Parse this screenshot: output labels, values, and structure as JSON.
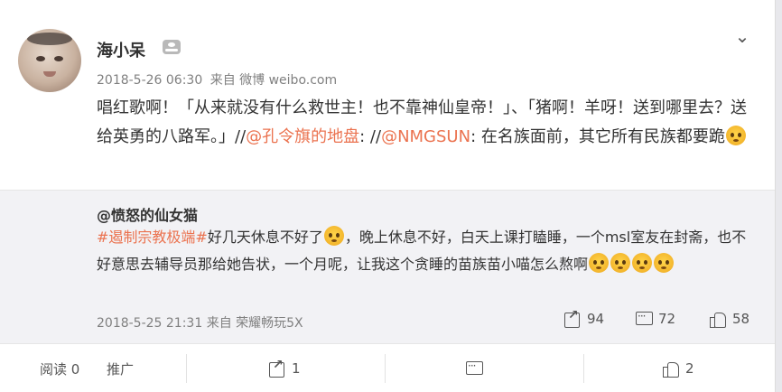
{
  "post": {
    "username": "海小呆",
    "timestamp": "2018-5-26 06:30",
    "source": "来自 微博 weibo.com",
    "text": {
      "p1": "唱红歌啊！「从来就没有什么救世主！也不靠神仙皇帝！」、「猪啊！羊呀！送到哪里去？送给英勇的八路军。」//",
      "mention1": "@孔令旗的地盘",
      "p2": ": //",
      "mention2": "@NMGSUN",
      "p3": ": 在名族面前，其它所有民族都要跪"
    }
  },
  "retweet": {
    "username": "@愤怒的仙女猫",
    "hashtag": "#遏制宗教极端#",
    "text1": "好几天休息不好了",
    "text2": "，晚上休息不好，白天上课打瞌睡，一个msl室友在封斋，也不好意思去辅导员那给她告状，一个月呢，让我这个贪睡的苗族苗小喵怎么熬啊",
    "timestamp": "2018-5-25 21:31",
    "source": "来自 荣耀畅玩5X",
    "reposts": "94",
    "comments": "72",
    "likes": "58"
  },
  "actions": {
    "reads": "阅读 0",
    "promote": "推广",
    "reposts": "1",
    "comments": "",
    "likes": "2"
  },
  "icons": [
    "chevron-down-icon",
    "vip-badge-icon",
    "emoji-icon",
    "repost-icon",
    "comment-icon",
    "like-icon"
  ]
}
